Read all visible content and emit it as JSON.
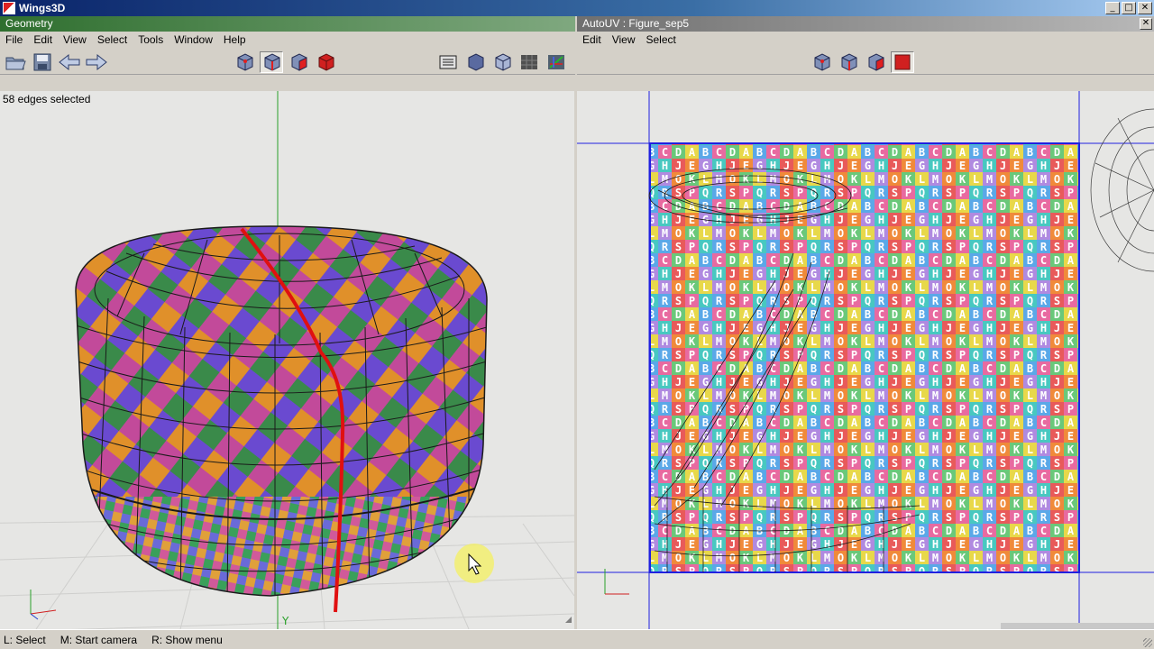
{
  "window": {
    "title": "Wings3D",
    "min_label": "_",
    "max_label": "□",
    "close_label": "✕"
  },
  "geometry": {
    "title": "Geometry",
    "menu": [
      "File",
      "Edit",
      "View",
      "Select",
      "Tools",
      "Window",
      "Help"
    ],
    "status": "58 edges selected",
    "axis_label": "Y"
  },
  "autouv": {
    "title": "AutoUV : Figure_sep5",
    "close_label": "✕",
    "menu": [
      "Edit",
      "View",
      "Select"
    ]
  },
  "uv_texture": {
    "letter_rows": [
      [
        "A",
        "B",
        "C",
        "D"
      ],
      [
        "E",
        "G",
        "H",
        "J"
      ],
      [
        "K",
        "L",
        "M",
        "O"
      ],
      [
        "P",
        "Q",
        "R",
        "S"
      ]
    ],
    "colors": [
      "#e8d84a",
      "#5aa8e8",
      "#e86aa0",
      "#6ac87a",
      "#f08a3a",
      "#b08ae0",
      "#48c8c0",
      "#e85a5a"
    ]
  },
  "status_bar": {
    "left_hint": "L: Select",
    "middle_hint": "M: Start camera",
    "right_hint": "R: Show menu"
  },
  "colors": {
    "selected_edge": "#e01010",
    "uv_border": "#2020e0",
    "axis_y": "#20a020",
    "axis_x": "#d02020"
  }
}
